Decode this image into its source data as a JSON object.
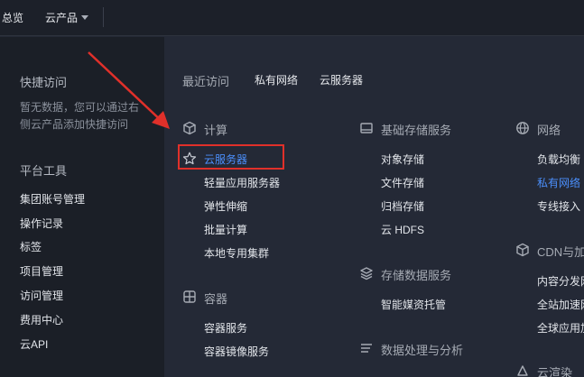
{
  "topbar": {
    "overview": "总览",
    "products": "云产品"
  },
  "sidebar": {
    "quick_access_title": "快捷访问",
    "quick_access_empty_line1": "暂无数据，您可以通过右",
    "quick_access_empty_line2": "侧云产品添加快捷访问",
    "platform_tools_title": "平台工具",
    "tools": [
      "集团账号管理",
      "操作记录",
      "标签",
      "项目管理",
      "访问管理",
      "费用中心",
      "云API"
    ]
  },
  "recent": {
    "label": "最近访问",
    "items": [
      "私有网络",
      "云服务器"
    ]
  },
  "categories": {
    "compute": {
      "title": "计算",
      "icon": "cube-icon",
      "items": [
        "云服务器",
        "轻量应用服务器",
        "弹性伸缩",
        "批量计算",
        "本地专用集群"
      ]
    },
    "container": {
      "title": "容器",
      "icon": "container-icon",
      "items": [
        "容器服务",
        "容器镜像服务"
      ]
    },
    "storage": {
      "title": "基础存储服务",
      "icon": "storage-icon",
      "items": [
        "对象存储",
        "文件存储",
        "归档存储",
        "云 HDFS"
      ]
    },
    "storage_data": {
      "title": "存储数据服务",
      "icon": "layers-icon",
      "items": [
        "智能媒资托管"
      ]
    },
    "data_processing": {
      "title": "数据处理与分析",
      "icon": "list-icon"
    },
    "network": {
      "title": "网络",
      "icon": "globe-icon",
      "items": [
        "负载均衡",
        "私有网络",
        "专线接入"
      ]
    },
    "cdn": {
      "title": "CDN与加",
      "icon": "box-icon",
      "items": [
        "内容分发网",
        "全站加速网",
        "全球应用加"
      ]
    },
    "render": {
      "title": "云渲染",
      "icon": "render-icon"
    }
  },
  "colors": {
    "active_link": "#4b8ffc",
    "highlight": "#e0302a"
  }
}
